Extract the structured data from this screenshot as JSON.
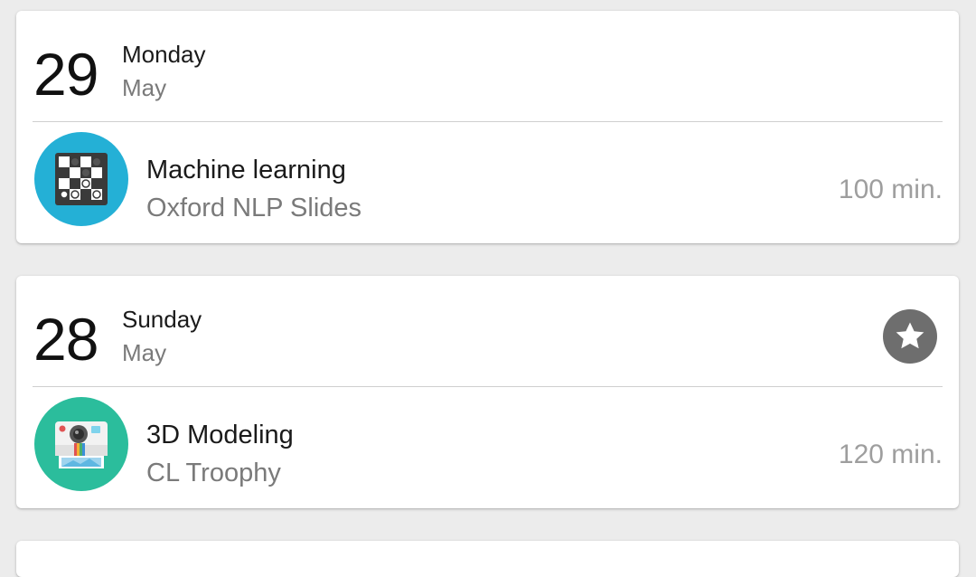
{
  "days": [
    {
      "day_number": "29",
      "weekday": "Monday",
      "month": "May",
      "starred": false,
      "entry": {
        "title": "Machine learning",
        "subtitle": "Oxford NLP Slides",
        "duration": "100 min.",
        "icon": "chessboard-icon",
        "icon_bg": "#24b0d6"
      }
    },
    {
      "day_number": "28",
      "weekday": "Sunday",
      "month": "May",
      "starred": true,
      "entry": {
        "title": "3D Modeling",
        "subtitle": "CL Troophy",
        "duration": "120 min.",
        "icon": "instant-camera-icon",
        "icon_bg": "#2bbd9c"
      }
    }
  ],
  "colors": {
    "background": "#ececec",
    "card": "#ffffff",
    "star_button": "#6e6e6e"
  }
}
